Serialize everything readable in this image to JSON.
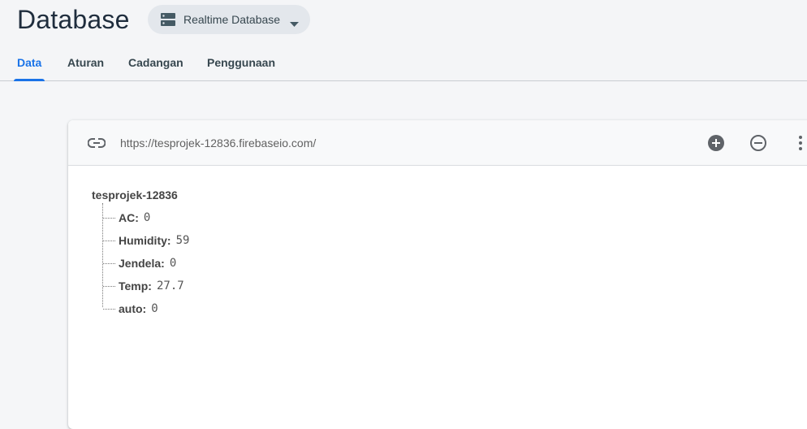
{
  "header": {
    "title": "Database",
    "db_selector_label": "Realtime Database"
  },
  "tabs": [
    {
      "label": "Data",
      "active": true
    },
    {
      "label": "Aturan",
      "active": false
    },
    {
      "label": "Cadangan",
      "active": false
    },
    {
      "label": "Penggunaan",
      "active": false
    }
  ],
  "toolbar": {
    "url": "https://tesprojek-12836.firebaseio.com/",
    "icons": [
      "link-icon",
      "add-circle-icon",
      "remove-circle-icon",
      "more-vert-icon"
    ]
  },
  "tree": {
    "root": "tesprojek-12836",
    "children": [
      {
        "key": "AC:",
        "value": "0"
      },
      {
        "key": "Humidity:",
        "value": "59"
      },
      {
        "key": "Jendela:",
        "value": "0"
      },
      {
        "key": "Temp:",
        "value": "27.7"
      },
      {
        "key": "auto:",
        "value": "0"
      }
    ]
  },
  "colors": {
    "accent": "#1a73e8",
    "background": "#f5f6f8",
    "selector_bg": "#e3e7ec"
  }
}
